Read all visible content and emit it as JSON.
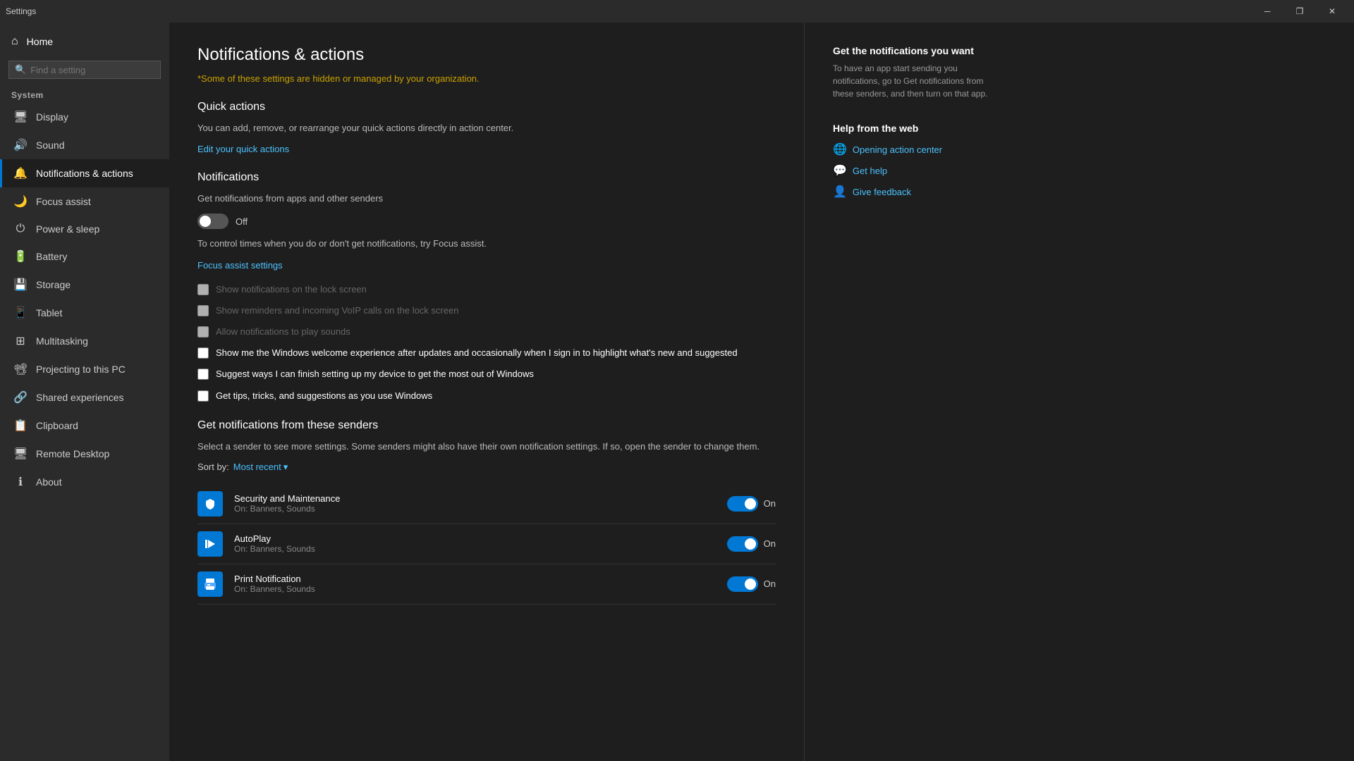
{
  "titlebar": {
    "title": "Settings",
    "minimize": "─",
    "restore": "❐",
    "close": "✕"
  },
  "sidebar": {
    "home_label": "Home",
    "search_placeholder": "Find a setting",
    "system_label": "System",
    "items": [
      {
        "id": "display",
        "label": "Display",
        "icon": "🖥"
      },
      {
        "id": "sound",
        "label": "Sound",
        "icon": "🔊"
      },
      {
        "id": "notifications",
        "label": "Notifications & actions",
        "icon": "🔔",
        "active": true
      },
      {
        "id": "focus",
        "label": "Focus assist",
        "icon": "🌙"
      },
      {
        "id": "power",
        "label": "Power & sleep",
        "icon": "⏻"
      },
      {
        "id": "battery",
        "label": "Battery",
        "icon": "🔋"
      },
      {
        "id": "storage",
        "label": "Storage",
        "icon": "💾"
      },
      {
        "id": "tablet",
        "label": "Tablet",
        "icon": "📱"
      },
      {
        "id": "multitasking",
        "label": "Multitasking",
        "icon": "⊞"
      },
      {
        "id": "projecting",
        "label": "Projecting to this PC",
        "icon": "📽"
      },
      {
        "id": "shared",
        "label": "Shared experiences",
        "icon": "🔗"
      },
      {
        "id": "clipboard",
        "label": "Clipboard",
        "icon": "📋"
      },
      {
        "id": "remote",
        "label": "Remote Desktop",
        "icon": "🖥"
      },
      {
        "id": "about",
        "label": "About",
        "icon": "ℹ"
      }
    ]
  },
  "main": {
    "page_title": "Notifications & actions",
    "org_warning": "*Some of these settings are hidden or managed by your organization.",
    "quick_actions": {
      "title": "Quick actions",
      "description": "You can add, remove, or rearrange your quick actions directly in action center.",
      "edit_link": "Edit your quick actions"
    },
    "notifications": {
      "title": "Notifications",
      "toggle_label": "Get notifications from apps and other senders",
      "toggle_state": "off",
      "toggle_text": "Off",
      "focus_desc": "To control times when you do or don't get notifications, try Focus assist.",
      "focus_link": "Focus assist settings",
      "checkboxes": [
        {
          "id": "lockscreen",
          "label": "Show notifications on the lock screen",
          "checked": false,
          "enabled": false
        },
        {
          "id": "voip",
          "label": "Show reminders and incoming VoIP calls on the lock screen",
          "checked": false,
          "enabled": false
        },
        {
          "id": "sounds",
          "label": "Allow notifications to play sounds",
          "checked": false,
          "enabled": false
        },
        {
          "id": "welcome",
          "label": "Show me the Windows welcome experience after updates and occasionally when I sign in to highlight what's new and suggested",
          "checked": false,
          "enabled": true
        },
        {
          "id": "suggest",
          "label": "Suggest ways I can finish setting up my device to get the most out of Windows",
          "checked": false,
          "enabled": true
        },
        {
          "id": "tips",
          "label": "Get tips, tricks, and suggestions as you use Windows",
          "checked": false,
          "enabled": true
        }
      ]
    },
    "senders": {
      "title": "Get notifications from these senders",
      "description": "Select a sender to see more settings. Some senders might also have their own notification settings. If so, open the sender to change them.",
      "sort_label": "Sort by:",
      "sort_value": "Most recent",
      "items": [
        {
          "name": "Security and Maintenance",
          "sub": "On: Banners, Sounds",
          "toggle": "on",
          "toggle_text": "On"
        },
        {
          "name": "AutoPlay",
          "sub": "On: Banners, Sounds",
          "toggle": "on",
          "toggle_text": "On"
        },
        {
          "name": "Print Notification",
          "sub": "On: Banners, Sounds",
          "toggle": "on",
          "toggle_text": "On"
        }
      ]
    }
  },
  "right_panel": {
    "get_notifications_title": "Get the notifications you want",
    "get_notifications_desc": "To have an app start sending you notifications, go to Get notifications from these senders, and then turn on that app.",
    "help_title": "Help from the web",
    "help_links": [
      {
        "id": "opening-action-center",
        "label": "Opening action center",
        "icon": "🌐"
      },
      {
        "id": "get-help",
        "label": "Get help",
        "icon": "💬"
      },
      {
        "id": "give-feedback",
        "label": "Give feedback",
        "icon": "👤"
      }
    ]
  }
}
